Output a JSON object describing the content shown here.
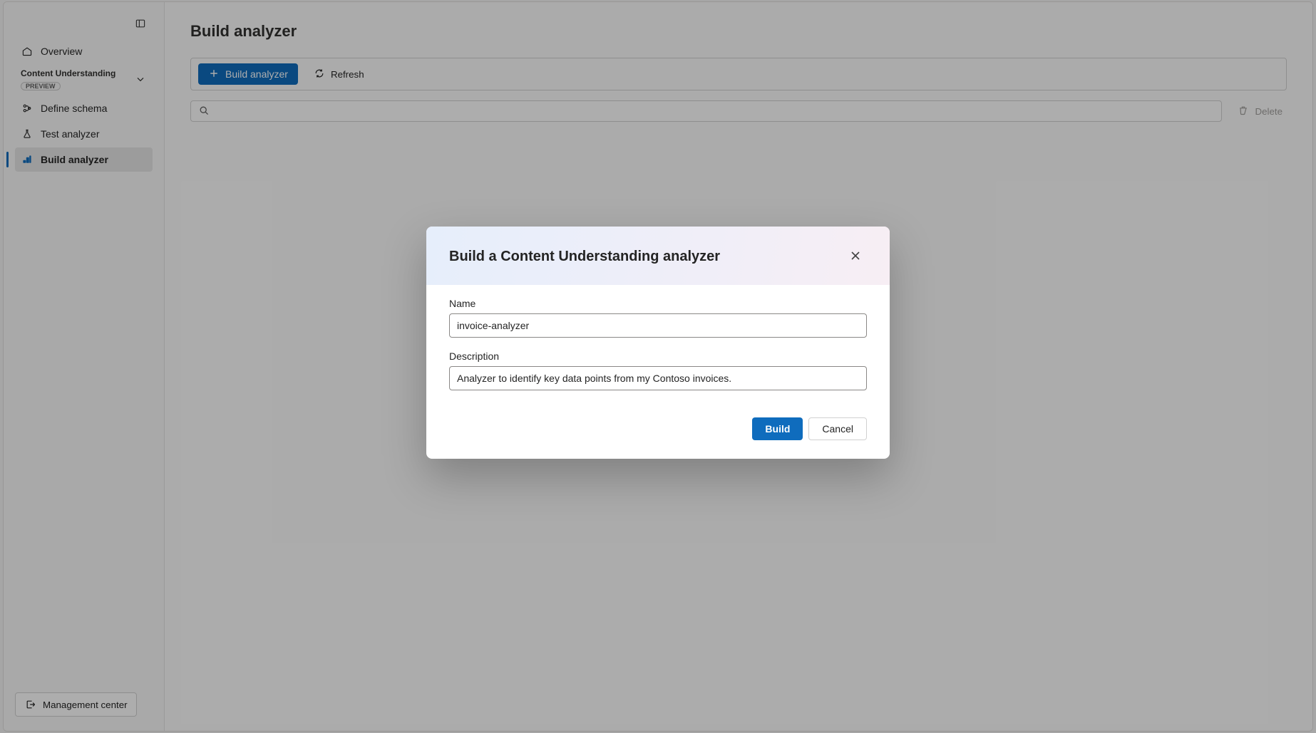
{
  "sidebar": {
    "overview_label": "Overview",
    "group": {
      "title": "Content Understanding",
      "badge": "PREVIEW"
    },
    "items": {
      "define_schema": "Define schema",
      "test_analyzer": "Test analyzer",
      "build_analyzer": "Build analyzer"
    },
    "management_center": "Management center"
  },
  "main": {
    "page_title": "Build analyzer",
    "toolbar": {
      "build_label": "Build analyzer",
      "refresh_label": "Refresh"
    },
    "search": {
      "placeholder": ""
    },
    "delete_label": "Delete"
  },
  "dialog": {
    "title": "Build a Content Understanding analyzer",
    "name_label": "Name",
    "name_value": "invoice-analyzer",
    "description_label": "Description",
    "description_value": "Analyzer to identify key data points from my Contoso invoices.",
    "build_label": "Build",
    "cancel_label": "Cancel"
  }
}
